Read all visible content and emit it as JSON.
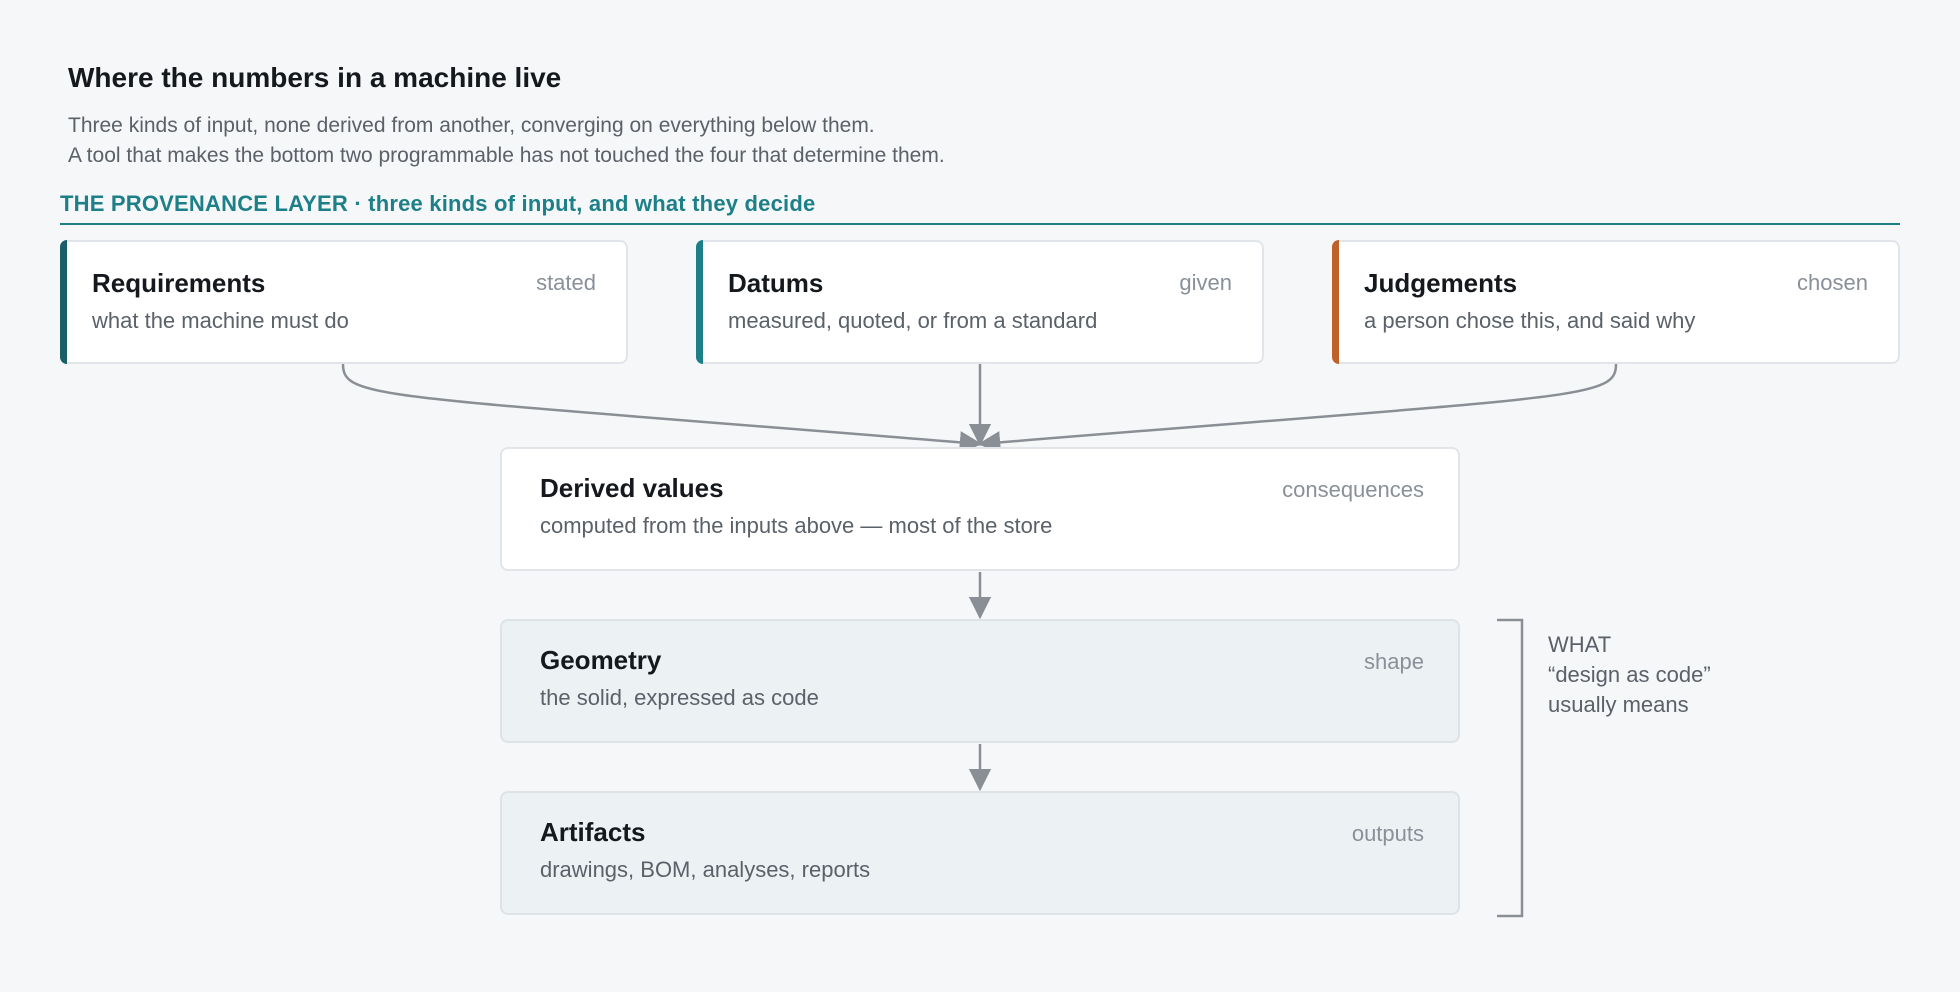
{
  "header": {
    "title": "Where the numbers in a machine live",
    "subtitle_line1": "Three kinds of input, none derived from another, converging on everything below them.",
    "subtitle_line2": "A tool that makes the bottom two programmable has not touched the four that determine them."
  },
  "provenance_layer": {
    "heading": "THE PROVENANCE LAYER · three kinds of input, and what they decide",
    "inputs": [
      {
        "title": "Requirements",
        "tag": "stated",
        "description": "what the machine must do",
        "accent_color": "#1b5e68"
      },
      {
        "title": "Datums",
        "tag": "given",
        "description": "measured, quoted, or from a standard",
        "accent_color": "#1d7f88"
      },
      {
        "title": "Judgements",
        "tag": "chosen",
        "description": "a person chose this, and said why",
        "accent_color": "#c0612b"
      }
    ]
  },
  "derived": {
    "title": "Derived values",
    "tag": "consequences",
    "description": "computed from the inputs above — most of the store"
  },
  "geometry": {
    "title": "Geometry",
    "tag": "shape",
    "description": "the solid, expressed as code"
  },
  "artifacts": {
    "title": "Artifacts",
    "tag": "outputs",
    "description": "drawings, BOM, analyses, reports"
  },
  "bracket": {
    "line1": "WHAT",
    "line2": "“design as code”",
    "line3": "usually means"
  },
  "colors": {
    "teal_heading": "#1d7f88",
    "connector": "#8a8f96",
    "shaded_card": "#ecf1f3"
  }
}
